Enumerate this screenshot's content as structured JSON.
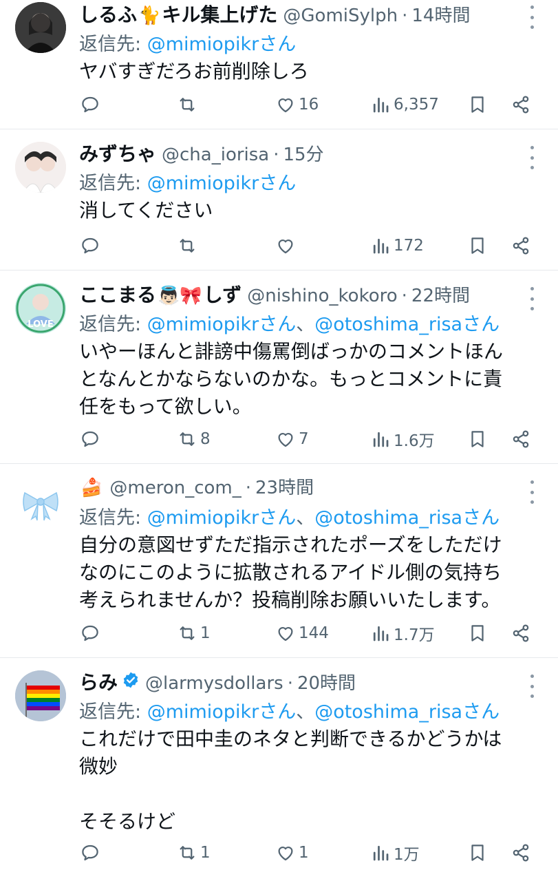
{
  "colors": {
    "accent": "#1d9bf0",
    "muted": "#536471",
    "text": "#0f1419",
    "verified": "#1d9bf0"
  },
  "reply_prefix": "返信先: ",
  "tweets": [
    {
      "name": "しるふ",
      "name_emoji": "🐈",
      "name_rest": "キル集上げた",
      "handle": "@GomiSylph",
      "time": "14時間",
      "reply_to_1": "@mimiopikrさん",
      "reply_sep": "",
      "reply_to_2": "",
      "text": "ヤバすぎだろお前削除しろ",
      "replies": "",
      "retweets": "",
      "likes": "16",
      "views": "6,357"
    },
    {
      "name": "みずちゃ",
      "name_emoji": "",
      "name_rest": "",
      "handle": "@cha_iorisa",
      "time": "15分",
      "reply_to_1": "@mimiopikrさん",
      "reply_sep": "",
      "reply_to_2": "",
      "text": "消してください",
      "replies": "",
      "retweets": "",
      "likes": "",
      "views": "172"
    },
    {
      "name": "ここまる",
      "name_emoji": "👼🏻🎀",
      "name_rest": "しず",
      "handle": "@nishino_kokoro",
      "time": "22時間",
      "reply_to_1": "@mimiopikrさん",
      "reply_sep": "、",
      "reply_to_2": "@otoshima_risaさん",
      "text": "いやーほんと誹謗中傷罵倒ばっかのコメントほんとなんとかならないのかな。もっとコメントに責任をもって欲しい。",
      "replies": "",
      "retweets": "8",
      "likes": "7",
      "views": "1.6万"
    },
    {
      "name": "",
      "name_emoji": "🍰",
      "name_rest": "",
      "handle": "@meron_com_",
      "time": "23時間",
      "reply_to_1": "@mimiopikrさん",
      "reply_sep": "、",
      "reply_to_2": "@otoshima_risaさん",
      "text": "自分の意図せずただ指示されたポーズをしただけなのにこのように拡散されるアイドル側の気持ち考えられませんか？投稿削除お願いいたします。",
      "replies": "",
      "retweets": "1",
      "likes": "144",
      "views": "1.7万"
    },
    {
      "name": "らみ",
      "name_emoji": "",
      "name_rest": "",
      "handle": "@larmysdollars",
      "time": "20時間",
      "reply_to_1": "@mimiopikrさん",
      "reply_sep": "、",
      "reply_to_2": "@otoshima_risaさん",
      "text": "これだけで田中圭のネタと判断できるかどうかは微妙\n\nそそるけど",
      "replies": "",
      "retweets": "1",
      "likes": "1",
      "views": "1万"
    }
  ]
}
